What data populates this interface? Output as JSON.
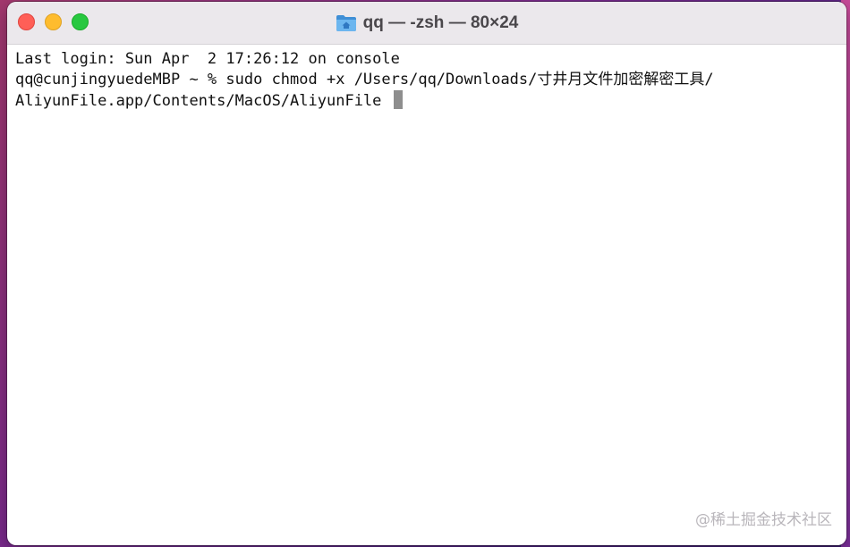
{
  "window": {
    "title": "qq — -zsh — 80×24",
    "title_icon": "home-folder-icon"
  },
  "terminal": {
    "lines": [
      "Last login: Sun Apr  2 17:26:12 on console",
      "qq@cunjingyuedeMBP ~ % sudo chmod +x /Users/qq/Downloads/寸井月文件加密解密工具/",
      "AliyunFile.app/Contents/MacOS/AliyunFile "
    ]
  },
  "watermark": "@稀土掘金技术社区",
  "colors": {
    "close": "#ff5f57",
    "minimize": "#febc2e",
    "zoom": "#28c840",
    "folder": "#5aa9e6"
  }
}
